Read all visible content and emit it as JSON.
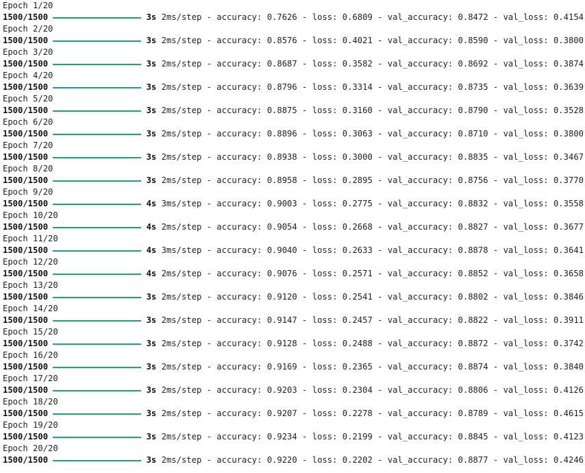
{
  "theme": {
    "bar_color": "#1aa86a"
  },
  "epochs": [
    {
      "header": "Epoch 1/20",
      "step": "1500/1500",
      "time": "3s",
      "per_step": "2ms/step",
      "accuracy": "0.7626",
      "loss": "0.6809",
      "val_accuracy": "0.8472",
      "val_loss": "0.4154"
    },
    {
      "header": "Epoch 2/20",
      "step": "1500/1500",
      "time": "3s",
      "per_step": "2ms/step",
      "accuracy": "0.8576",
      "loss": "0.4021",
      "val_accuracy": "0.8590",
      "val_loss": "0.3800"
    },
    {
      "header": "Epoch 3/20",
      "step": "1500/1500",
      "time": "3s",
      "per_step": "2ms/step",
      "accuracy": "0.8687",
      "loss": "0.3582",
      "val_accuracy": "0.8692",
      "val_loss": "0.3874"
    },
    {
      "header": "Epoch 4/20",
      "step": "1500/1500",
      "time": "3s",
      "per_step": "2ms/step",
      "accuracy": "0.8796",
      "loss": "0.3314",
      "val_accuracy": "0.8735",
      "val_loss": "0.3639"
    },
    {
      "header": "Epoch 5/20",
      "step": "1500/1500",
      "time": "3s",
      "per_step": "2ms/step",
      "accuracy": "0.8875",
      "loss": "0.3160",
      "val_accuracy": "0.8790",
      "val_loss": "0.3528"
    },
    {
      "header": "Epoch 6/20",
      "step": "1500/1500",
      "time": "3s",
      "per_step": "2ms/step",
      "accuracy": "0.8896",
      "loss": "0.3063",
      "val_accuracy": "0.8710",
      "val_loss": "0.3800"
    },
    {
      "header": "Epoch 7/20",
      "step": "1500/1500",
      "time": "3s",
      "per_step": "2ms/step",
      "accuracy": "0.8938",
      "loss": "0.3000",
      "val_accuracy": "0.8835",
      "val_loss": "0.3467"
    },
    {
      "header": "Epoch 8/20",
      "step": "1500/1500",
      "time": "3s",
      "per_step": "2ms/step",
      "accuracy": "0.8958",
      "loss": "0.2895",
      "val_accuracy": "0.8756",
      "val_loss": "0.3770"
    },
    {
      "header": "Epoch 9/20",
      "step": "1500/1500",
      "time": "4s",
      "per_step": "3ms/step",
      "accuracy": "0.9003",
      "loss": "0.2775",
      "val_accuracy": "0.8832",
      "val_loss": "0.3558"
    },
    {
      "header": "Epoch 10/20",
      "step": "1500/1500",
      "time": "4s",
      "per_step": "2ms/step",
      "accuracy": "0.9054",
      "loss": "0.2668",
      "val_accuracy": "0.8827",
      "val_loss": "0.3677"
    },
    {
      "header": "Epoch 11/20",
      "step": "1500/1500",
      "time": "4s",
      "per_step": "3ms/step",
      "accuracy": "0.9040",
      "loss": "0.2633",
      "val_accuracy": "0.8878",
      "val_loss": "0.3641"
    },
    {
      "header": "Epoch 12/20",
      "step": "1500/1500",
      "time": "4s",
      "per_step": "2ms/step",
      "accuracy": "0.9076",
      "loss": "0.2571",
      "val_accuracy": "0.8852",
      "val_loss": "0.3658"
    },
    {
      "header": "Epoch 13/20",
      "step": "1500/1500",
      "time": "3s",
      "per_step": "2ms/step",
      "accuracy": "0.9120",
      "loss": "0.2541",
      "val_accuracy": "0.8802",
      "val_loss": "0.3846"
    },
    {
      "header": "Epoch 14/20",
      "step": "1500/1500",
      "time": "3s",
      "per_step": "2ms/step",
      "accuracy": "0.9147",
      "loss": "0.2457",
      "val_accuracy": "0.8822",
      "val_loss": "0.3911"
    },
    {
      "header": "Epoch 15/20",
      "step": "1500/1500",
      "time": "3s",
      "per_step": "2ms/step",
      "accuracy": "0.9128",
      "loss": "0.2488",
      "val_accuracy": "0.8872",
      "val_loss": "0.3742"
    },
    {
      "header": "Epoch 16/20",
      "step": "1500/1500",
      "time": "3s",
      "per_step": "2ms/step",
      "accuracy": "0.9169",
      "loss": "0.2365",
      "val_accuracy": "0.8874",
      "val_loss": "0.3840"
    },
    {
      "header": "Epoch 17/20",
      "step": "1500/1500",
      "time": "3s",
      "per_step": "2ms/step",
      "accuracy": "0.9203",
      "loss": "0.2304",
      "val_accuracy": "0.8806",
      "val_loss": "0.4126"
    },
    {
      "header": "Epoch 18/20",
      "step": "1500/1500",
      "time": "3s",
      "per_step": "2ms/step",
      "accuracy": "0.9207",
      "loss": "0.2278",
      "val_accuracy": "0.8789",
      "val_loss": "0.4615"
    },
    {
      "header": "Epoch 19/20",
      "step": "1500/1500",
      "time": "3s",
      "per_step": "2ms/step",
      "accuracy": "0.9234",
      "loss": "0.2199",
      "val_accuracy": "0.8845",
      "val_loss": "0.4123"
    },
    {
      "header": "Epoch 20/20",
      "step": "1500/1500",
      "time": "3s",
      "per_step": "2ms/step",
      "accuracy": "0.9220",
      "loss": "0.2202",
      "val_accuracy": "0.8877",
      "val_loss": "0.4246"
    }
  ]
}
